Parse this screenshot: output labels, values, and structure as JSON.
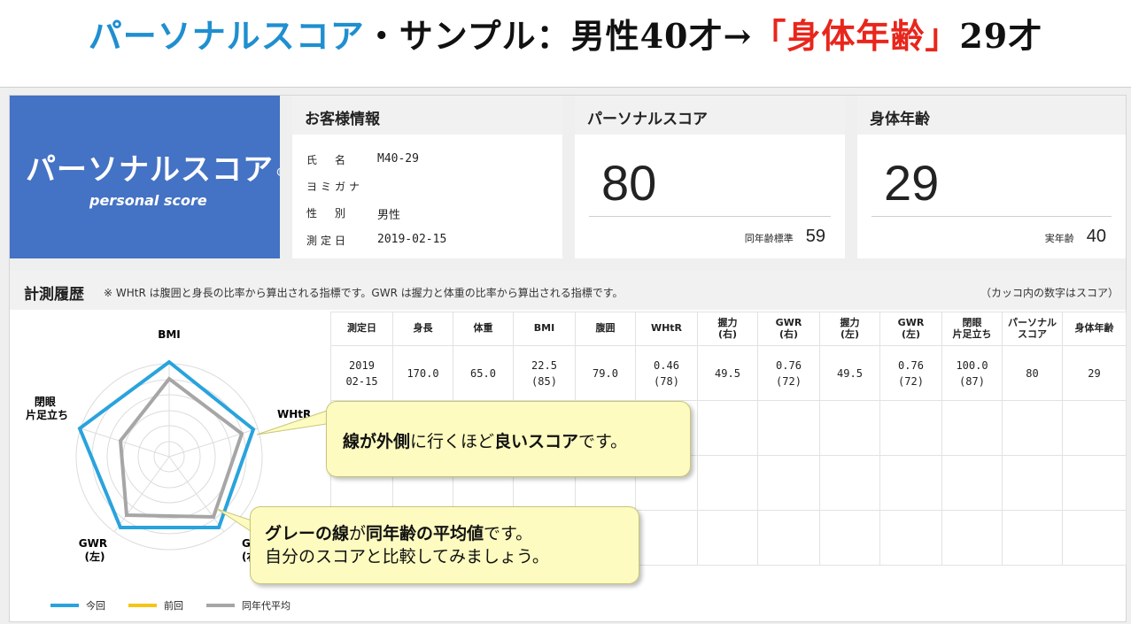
{
  "title": {
    "part1": "パーソナルスコア",
    "part2": "・サンプル：男性40才→",
    "part3": "「身体年齢」",
    "part4": "29才"
  },
  "logo": {
    "main": "パーソナルスコア",
    "mark": "®",
    "sub": "personal score"
  },
  "customer": {
    "heading": "お客様情報",
    "rows": [
      {
        "label": "氏　名",
        "value": "M40-29"
      },
      {
        "label": "ヨミガナ",
        "value": ""
      },
      {
        "label": "性　別",
        "value": "男性"
      },
      {
        "label": "測定日",
        "value": "2019-02-15"
      }
    ]
  },
  "score_card": {
    "heading": "パーソナルスコア",
    "value": "80",
    "sub_label": "同年齢標準",
    "sub_value": "59"
  },
  "age_card": {
    "heading": "身体年齢",
    "value": "29",
    "sub_label": "実年齢",
    "sub_value": "40"
  },
  "history": {
    "title": "計測履歴",
    "note": "※ WHtR は腹囲と身長の比率から算出される指標です。GWR は握力と体重の比率から算出される指標です。",
    "right_note": "（カッコ内の数字はスコア）",
    "headers": [
      "測定日",
      "身長",
      "体重",
      "BMI",
      "腹囲",
      "WHtR",
      "握力\n(右)",
      "GWR\n(右)",
      "握力\n(左)",
      "GWR\n(左)",
      "閉眼\n片足立ち",
      "パーソナル\nスコア",
      "身体年齢"
    ],
    "row": [
      "2019\n02-15",
      "170.0",
      "65.0",
      "22.5\n(85)",
      "79.0",
      "0.46\n(78)",
      "49.5",
      "0.76\n(72)",
      "49.5",
      "0.76\n(72)",
      "100.0\n(87)",
      "80",
      "29"
    ]
  },
  "radar": {
    "labels": {
      "bmi": "BMI",
      "whtr": "WHtR",
      "gwr_right": "GWR\n(右)",
      "gwr_left": "GWR\n(左)",
      "balance": "閉眼\n片足立ち"
    }
  },
  "legend": [
    {
      "label": "今回",
      "color": "#29a3dd"
    },
    {
      "label": "前回",
      "color": "#f5c518"
    },
    {
      "label": "同年代平均",
      "color": "#a6a6a6"
    }
  ],
  "callout1": {
    "pre": "線が外側",
    "mid": "に行くほど",
    "bold": "良いスコア",
    "post": "です。"
  },
  "callout2": {
    "line1_bold1": "グレーの線",
    "line1_text1": "が",
    "line1_bold2": "同年齢の平均値",
    "line1_text2": "です。",
    "line2": "自分のスコアと比較してみましょう。"
  },
  "colors": {
    "title_blue": "#1f8fd0",
    "title_red": "#e8261c",
    "logo_bg": "#4472c4",
    "current": "#29a3dd",
    "average": "#a6a6a6",
    "callout_bg": "#fdfbbf"
  }
}
